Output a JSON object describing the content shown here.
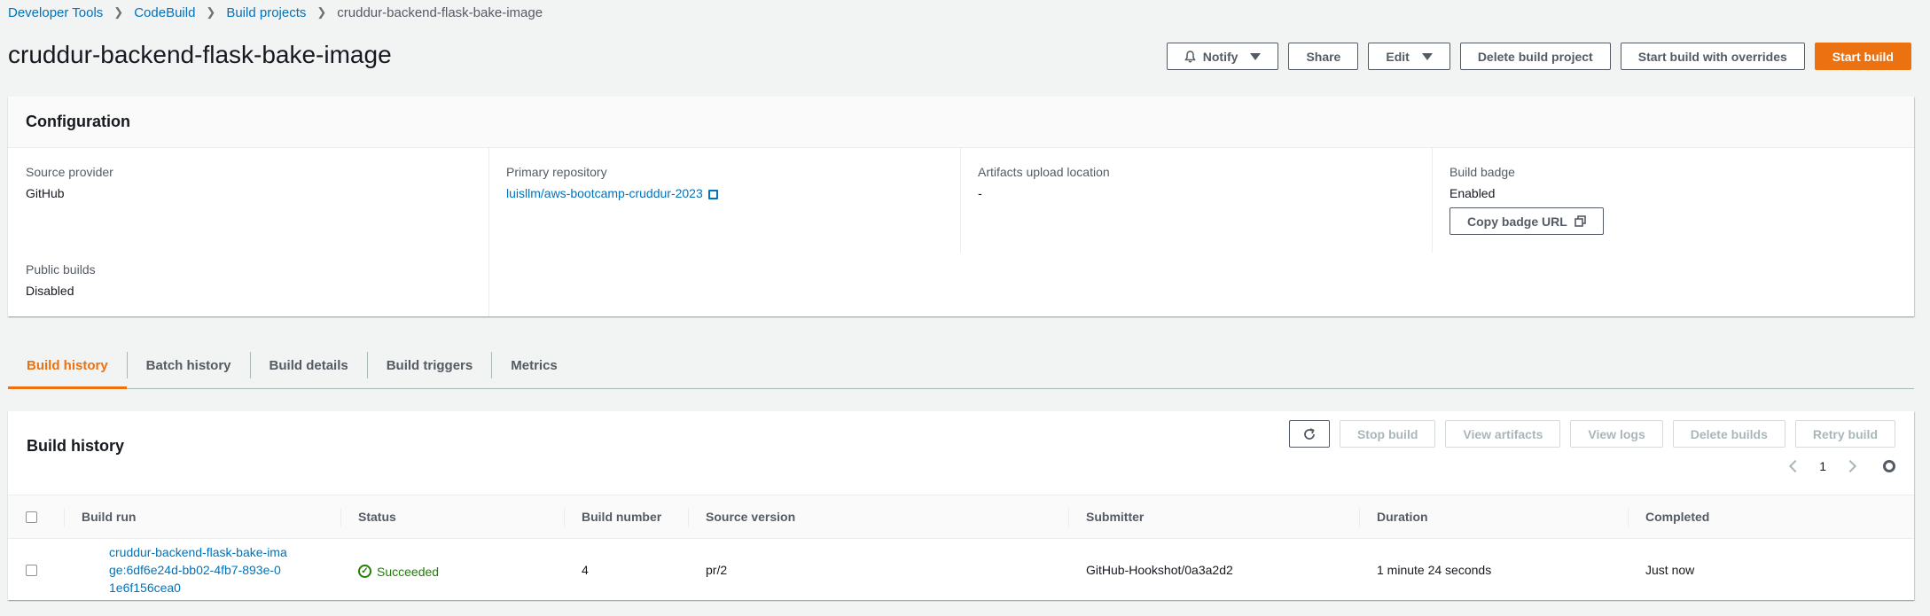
{
  "breadcrumb": [
    "Developer Tools",
    "CodeBuild",
    "Build projects",
    "cruddur-backend-flask-bake-image"
  ],
  "page_title": "cruddur-backend-flask-bake-image",
  "header_actions": {
    "notify": "Notify",
    "share": "Share",
    "edit": "Edit",
    "delete_project": "Delete build project",
    "start_overrides": "Start build with overrides",
    "start_build": "Start build"
  },
  "configuration": {
    "title": "Configuration",
    "source_provider": {
      "label": "Source provider",
      "value": "GitHub"
    },
    "primary_repository": {
      "label": "Primary repository",
      "value": "luisllm/aws-bootcamp-cruddur-2023"
    },
    "artifacts": {
      "label": "Artifacts upload location",
      "value": "-"
    },
    "build_badge": {
      "label": "Build badge",
      "value": "Enabled",
      "copy_button": "Copy badge URL"
    },
    "public_builds": {
      "label": "Public builds",
      "value": "Disabled"
    }
  },
  "tabs": [
    "Build history",
    "Batch history",
    "Build details",
    "Build triggers",
    "Metrics"
  ],
  "history": {
    "title": "Build history",
    "actions": {
      "stop": "Stop build",
      "artifacts": "View artifacts",
      "logs": "View logs",
      "delete": "Delete builds",
      "retry": "Retry build"
    },
    "page": "1",
    "columns": [
      "Build run",
      "Status",
      "Build number",
      "Source version",
      "Submitter",
      "Duration",
      "Completed"
    ],
    "rows": [
      {
        "build_run": "cruddur-backend-flask-bake-image:6df6e24d-bb02-4fb7-893e-01e6f156cea0",
        "status": "Succeeded",
        "build_number": "4",
        "source_version": "pr/2",
        "submitter": "GitHub-Hookshot/0a3a2d2",
        "duration": "1 minute 24 seconds",
        "completed": "Just now"
      }
    ]
  },
  "colors": {
    "accent": "#ec7211",
    "link": "#0073bb",
    "success": "#1d8102"
  },
  "icons": [
    "bell-icon",
    "caret-down-icon",
    "external-link-icon",
    "copy-icon",
    "refresh-icon",
    "chevron-left-icon",
    "chevron-right-icon",
    "gear-icon",
    "checkbox",
    "success-icon"
  ]
}
